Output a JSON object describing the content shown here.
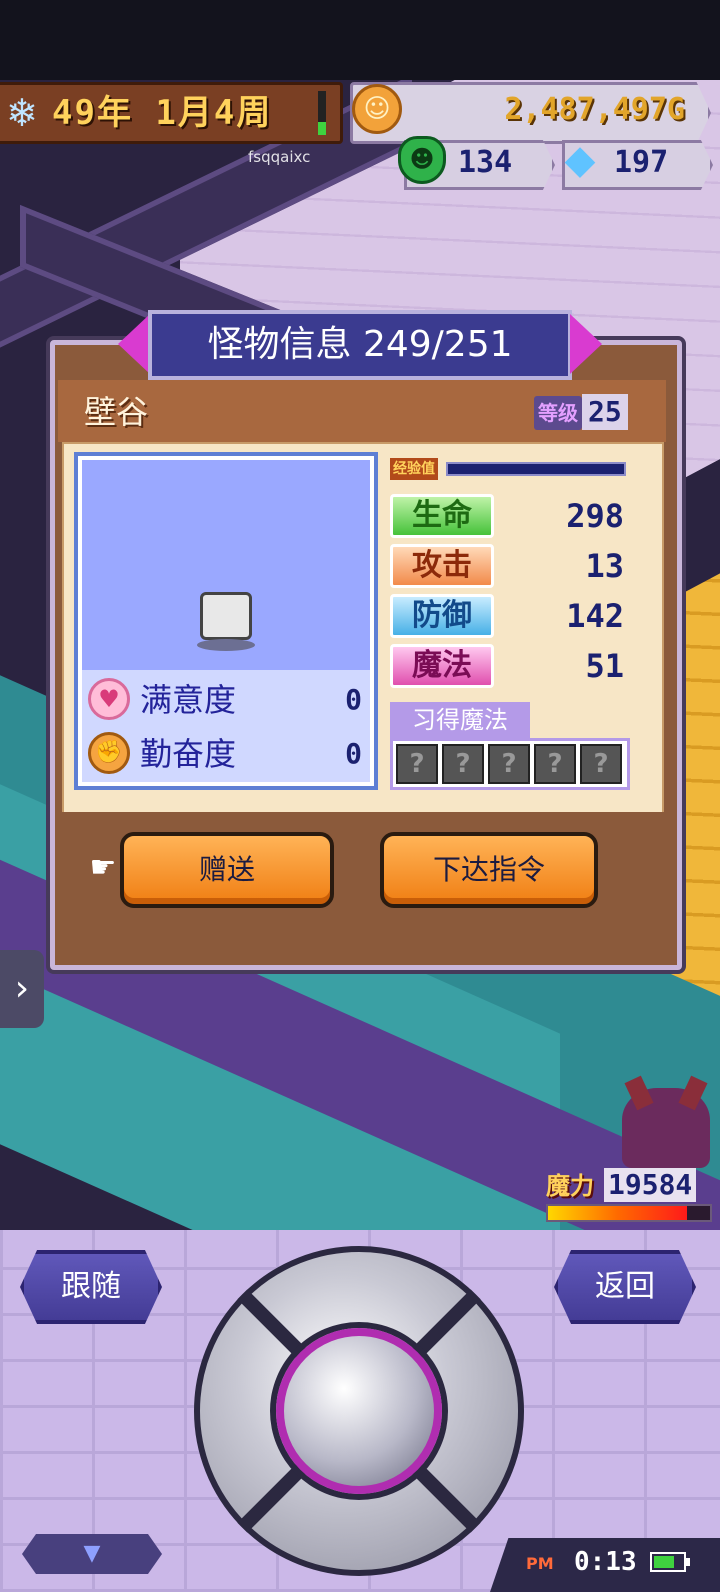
{
  "hud": {
    "date_text": "49年 1月4周",
    "date_icon": "snowflake-icon",
    "date_progress": 0.3,
    "gold": "2,487,497G",
    "monster_count": "134",
    "gem_count": "197",
    "user_id": "fsqqaixc"
  },
  "dialog": {
    "title": "怪物信息 249/251",
    "monster_name": "壁谷",
    "level_label": "等级",
    "level_value": "25",
    "exp_label": "经验值",
    "exp_progress": 0.0,
    "satisfaction_label": "满意度",
    "satisfaction_value": "0",
    "diligence_label": "勤奋度",
    "diligence_value": "0",
    "stats": [
      {
        "label": "生命",
        "value": "298"
      },
      {
        "label": "攻击",
        "value": "13"
      },
      {
        "label": "防御",
        "value": "142"
      },
      {
        "label": "魔法",
        "value": "51"
      }
    ],
    "learned_magic_label": "习得魔法",
    "magic_slots": [
      "?",
      "?",
      "?",
      "?",
      "?"
    ],
    "give_button": "赠送",
    "order_button": "下达指令"
  },
  "mana": {
    "label": "魔力",
    "value": "19584",
    "progress": 0.88
  },
  "controls": {
    "follow_button": "跟随",
    "back_button": "返回"
  },
  "status": {
    "ampm": "PM",
    "time": "0:13",
    "battery_level": 0.7
  },
  "colors": {
    "dialog_brown": "#8b5a3b",
    "title_blue": "#3b3b90",
    "button_orange": "#f07e12",
    "accent_magenta": "#d93bd0"
  }
}
